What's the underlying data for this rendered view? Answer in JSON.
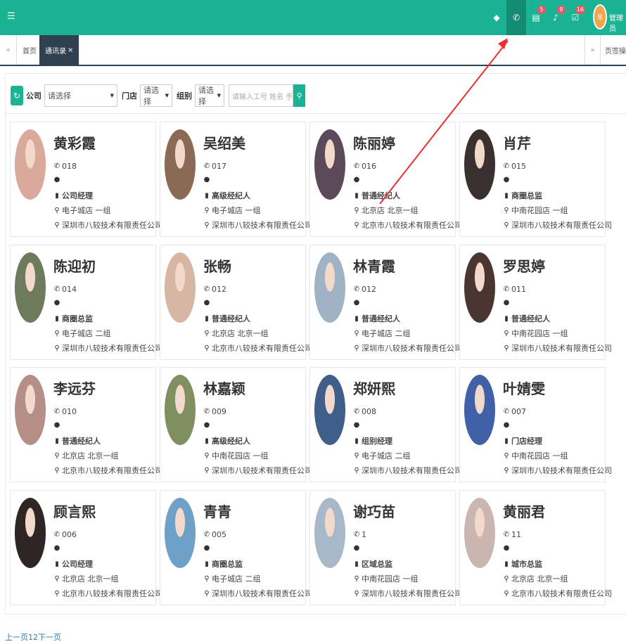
{
  "topbar": {
    "menu_icon": "hamburger-icon",
    "icons": [
      {
        "name": "dashboard-icon",
        "glyph": "⬤",
        "badge": ""
      },
      {
        "name": "phone-icon",
        "glyph": "✆",
        "badge": ""
      },
      {
        "name": "document-icon",
        "glyph": "▤",
        "badge": "5"
      },
      {
        "name": "bell-icon",
        "glyph": "🔔",
        "badge": "8"
      },
      {
        "name": "task-icon",
        "glyph": "☑",
        "badge": "16"
      }
    ],
    "avatar_text": "8",
    "user_label": "管理员",
    "accent": "#1ab394"
  },
  "tabs": {
    "home": "首页",
    "current": "通讯录",
    "close": "×",
    "page_ops": "页签操作"
  },
  "filter": {
    "company_label": "公司",
    "company_value": "请选择",
    "store_label": "门店",
    "store_value": "请选择",
    "group_label": "组别",
    "group_value": "请选择",
    "search_placeholder": "请输入工号 姓名 手机"
  },
  "contacts": [
    {
      "name": "黄彩霞",
      "id": "018",
      "role": "公司经理",
      "store": "电子城店 一组",
      "company": "深圳市八较技术有限责任公司",
      "photo_bg": "#d9a99b"
    },
    {
      "name": "吴绍美",
      "id": "017",
      "role": "高级经纪人",
      "store": "电子城店 一组",
      "company": "深圳市八较技术有限责任公司",
      "photo_bg": "#8a6a55"
    },
    {
      "name": "陈丽婷",
      "id": "016",
      "role": "普通经纪人",
      "store": "北京店 北京一组",
      "company": "北京市八较技术有限责任公司",
      "photo_bg": "#5b4a5a"
    },
    {
      "name": "肖芹",
      "id": "015",
      "role": "商圈总监",
      "store": "中南花园店 一组",
      "company": "深圳市八较技术有限责任公司",
      "photo_bg": "#3a3030"
    },
    {
      "name": "陈迎初",
      "id": "014",
      "role": "商圈总监",
      "store": "电子城店 二组",
      "company": "深圳市八较技术有限责任公司",
      "photo_bg": "#6e7a5c"
    },
    {
      "name": "张畅",
      "id": "012",
      "role": "普通经纪人",
      "store": "北京店 北京一组",
      "company": "北京市八较技术有限责任公司",
      "photo_bg": "#d8b6a4"
    },
    {
      "name": "林青霞",
      "id": "012",
      "role": "普通经纪人",
      "store": "电子城店 二组",
      "company": "深圳市八较技术有限责任公司",
      "photo_bg": "#9fb3c4"
    },
    {
      "name": "罗思婷",
      "id": "011",
      "role": "普通经纪人",
      "store": "中南花园店 一组",
      "company": "深圳市八较技术有限责任公司",
      "photo_bg": "#4a3530"
    },
    {
      "name": "李远芬",
      "id": "010",
      "role": "普通经纪人",
      "store": "北京店 北京一组",
      "company": "北京市八较技术有限责任公司",
      "photo_bg": "#b58f85"
    },
    {
      "name": "林嘉颖",
      "id": "009",
      "role": "高级经纪人",
      "store": "中南花园店 一组",
      "company": "深圳市八较技术有限责任公司",
      "photo_bg": "#7f8f5f"
    },
    {
      "name": "郑妍熙",
      "id": "008",
      "role": "组别经理",
      "store": "电子城店 二组",
      "company": "深圳市八较技术有限责任公司",
      "photo_bg": "#3f5f8a"
    },
    {
      "name": "叶婧雯",
      "id": "007",
      "role": "门店经理",
      "store": "中南花园店 一组",
      "company": "深圳市八较技术有限责任公司",
      "photo_bg": "#4060a8"
    },
    {
      "name": "顾言熙",
      "id": "006",
      "role": "公司经理",
      "store": "北京店 北京一组",
      "company": "北京市八较技术有限责任公司",
      "photo_bg": "#2e2624"
    },
    {
      "name": "青青",
      "id": "005",
      "role": "商圈总监",
      "store": "电子城店 二组",
      "company": "深圳市八较技术有限责任公司",
      "photo_bg": "#6fa0c8"
    },
    {
      "name": "谢巧苗",
      "id": "1",
      "role": "区域总监",
      "store": "中南花园店 一组",
      "company": "深圳市八较技术有限责任公司",
      "photo_bg": "#a7b9c8"
    },
    {
      "name": "黄丽君",
      "id": "11",
      "role": "城市总监",
      "store": "北京店 北京一组",
      "company": "北京市八较技术有限责任公司",
      "photo_bg": "#cbb5b0"
    }
  ],
  "pager": {
    "prev": "上一页",
    "p1": "1",
    "p2": "2",
    "next": "下一页"
  },
  "annotation_color": "#e8302f"
}
